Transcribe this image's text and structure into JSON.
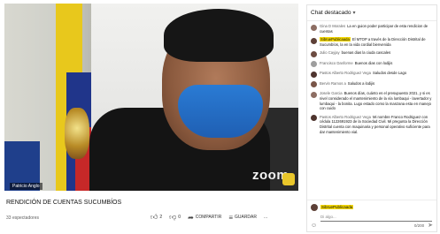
{
  "video": {
    "name_tag": "Patricio Anglo",
    "zoom_label": "zoom"
  },
  "below": {
    "title": "RENDICIÓN DE CUENTAS SUCUMBÍOS",
    "views": "33 espectadores",
    "like_count": "2",
    "dislike_count": "0",
    "share_label": "COMPARTIR",
    "save_label": "GUARDAR",
    "more_label": "..."
  },
  "chat": {
    "header_title": "Chat destacado",
    "messages": [
      {
        "author": "Gina D Morales",
        "text": "La en guion poder participar de esta rendicion de cuentas",
        "avatar_color": "#8d6e63",
        "highlight": false
      },
      {
        "author": "SibruePublicaada",
        "text": "El MTOP a través de la Dirección Distrital de Sucumbíos, la en la vida cordial bienvenida",
        "avatar_color": "#5d4037",
        "highlight": true
      },
      {
        "author": "Julio Cayjay",
        "text": "buenas dias la ciuda cascales",
        "avatar_color": "#6d4c41",
        "highlight": false
      },
      {
        "author": "Francisco Danforme",
        "text": "Buenos dias con lodijis",
        "avatar_color": "#9e9e9e",
        "highlight": false
      },
      {
        "author": "Pastos Alberto Rodriguez Vega",
        "text": "Saludos desde Lago",
        "avatar_color": "#4e342e",
        "highlight": false
      },
      {
        "author": "Bervin Ramos a",
        "text": "Saludos a lodijis",
        "avatar_color": "#795548",
        "highlight": false
      },
      {
        "author": "Josele Garcia",
        "text": "Buenos días, cuánto es el presupuesto 2021, y si es nivel considerado el mantenimiento de la vía lumbaqui - lavertador y lumbaqui - la bonita. Lugo estado como la manzana esta en manejo con cuido",
        "avatar_color": "#8d6e63",
        "highlight": false
      },
      {
        "author": "Pastos Alberto Rodriguez Vega",
        "text": "Mi nombre Franco Rodriguez con cédula 1122691923 de la Sociedad Civil. Mi pregunta la Dirección Distrital cuenta con maquinaria y personal operativo suficiente para dar mantenimiento vial.",
        "avatar_color": "#4e342e",
        "highlight": false
      }
    ],
    "input": {
      "author": "SibruePublicaada",
      "placeholder": "Di algo...",
      "counter": "0/200"
    }
  }
}
